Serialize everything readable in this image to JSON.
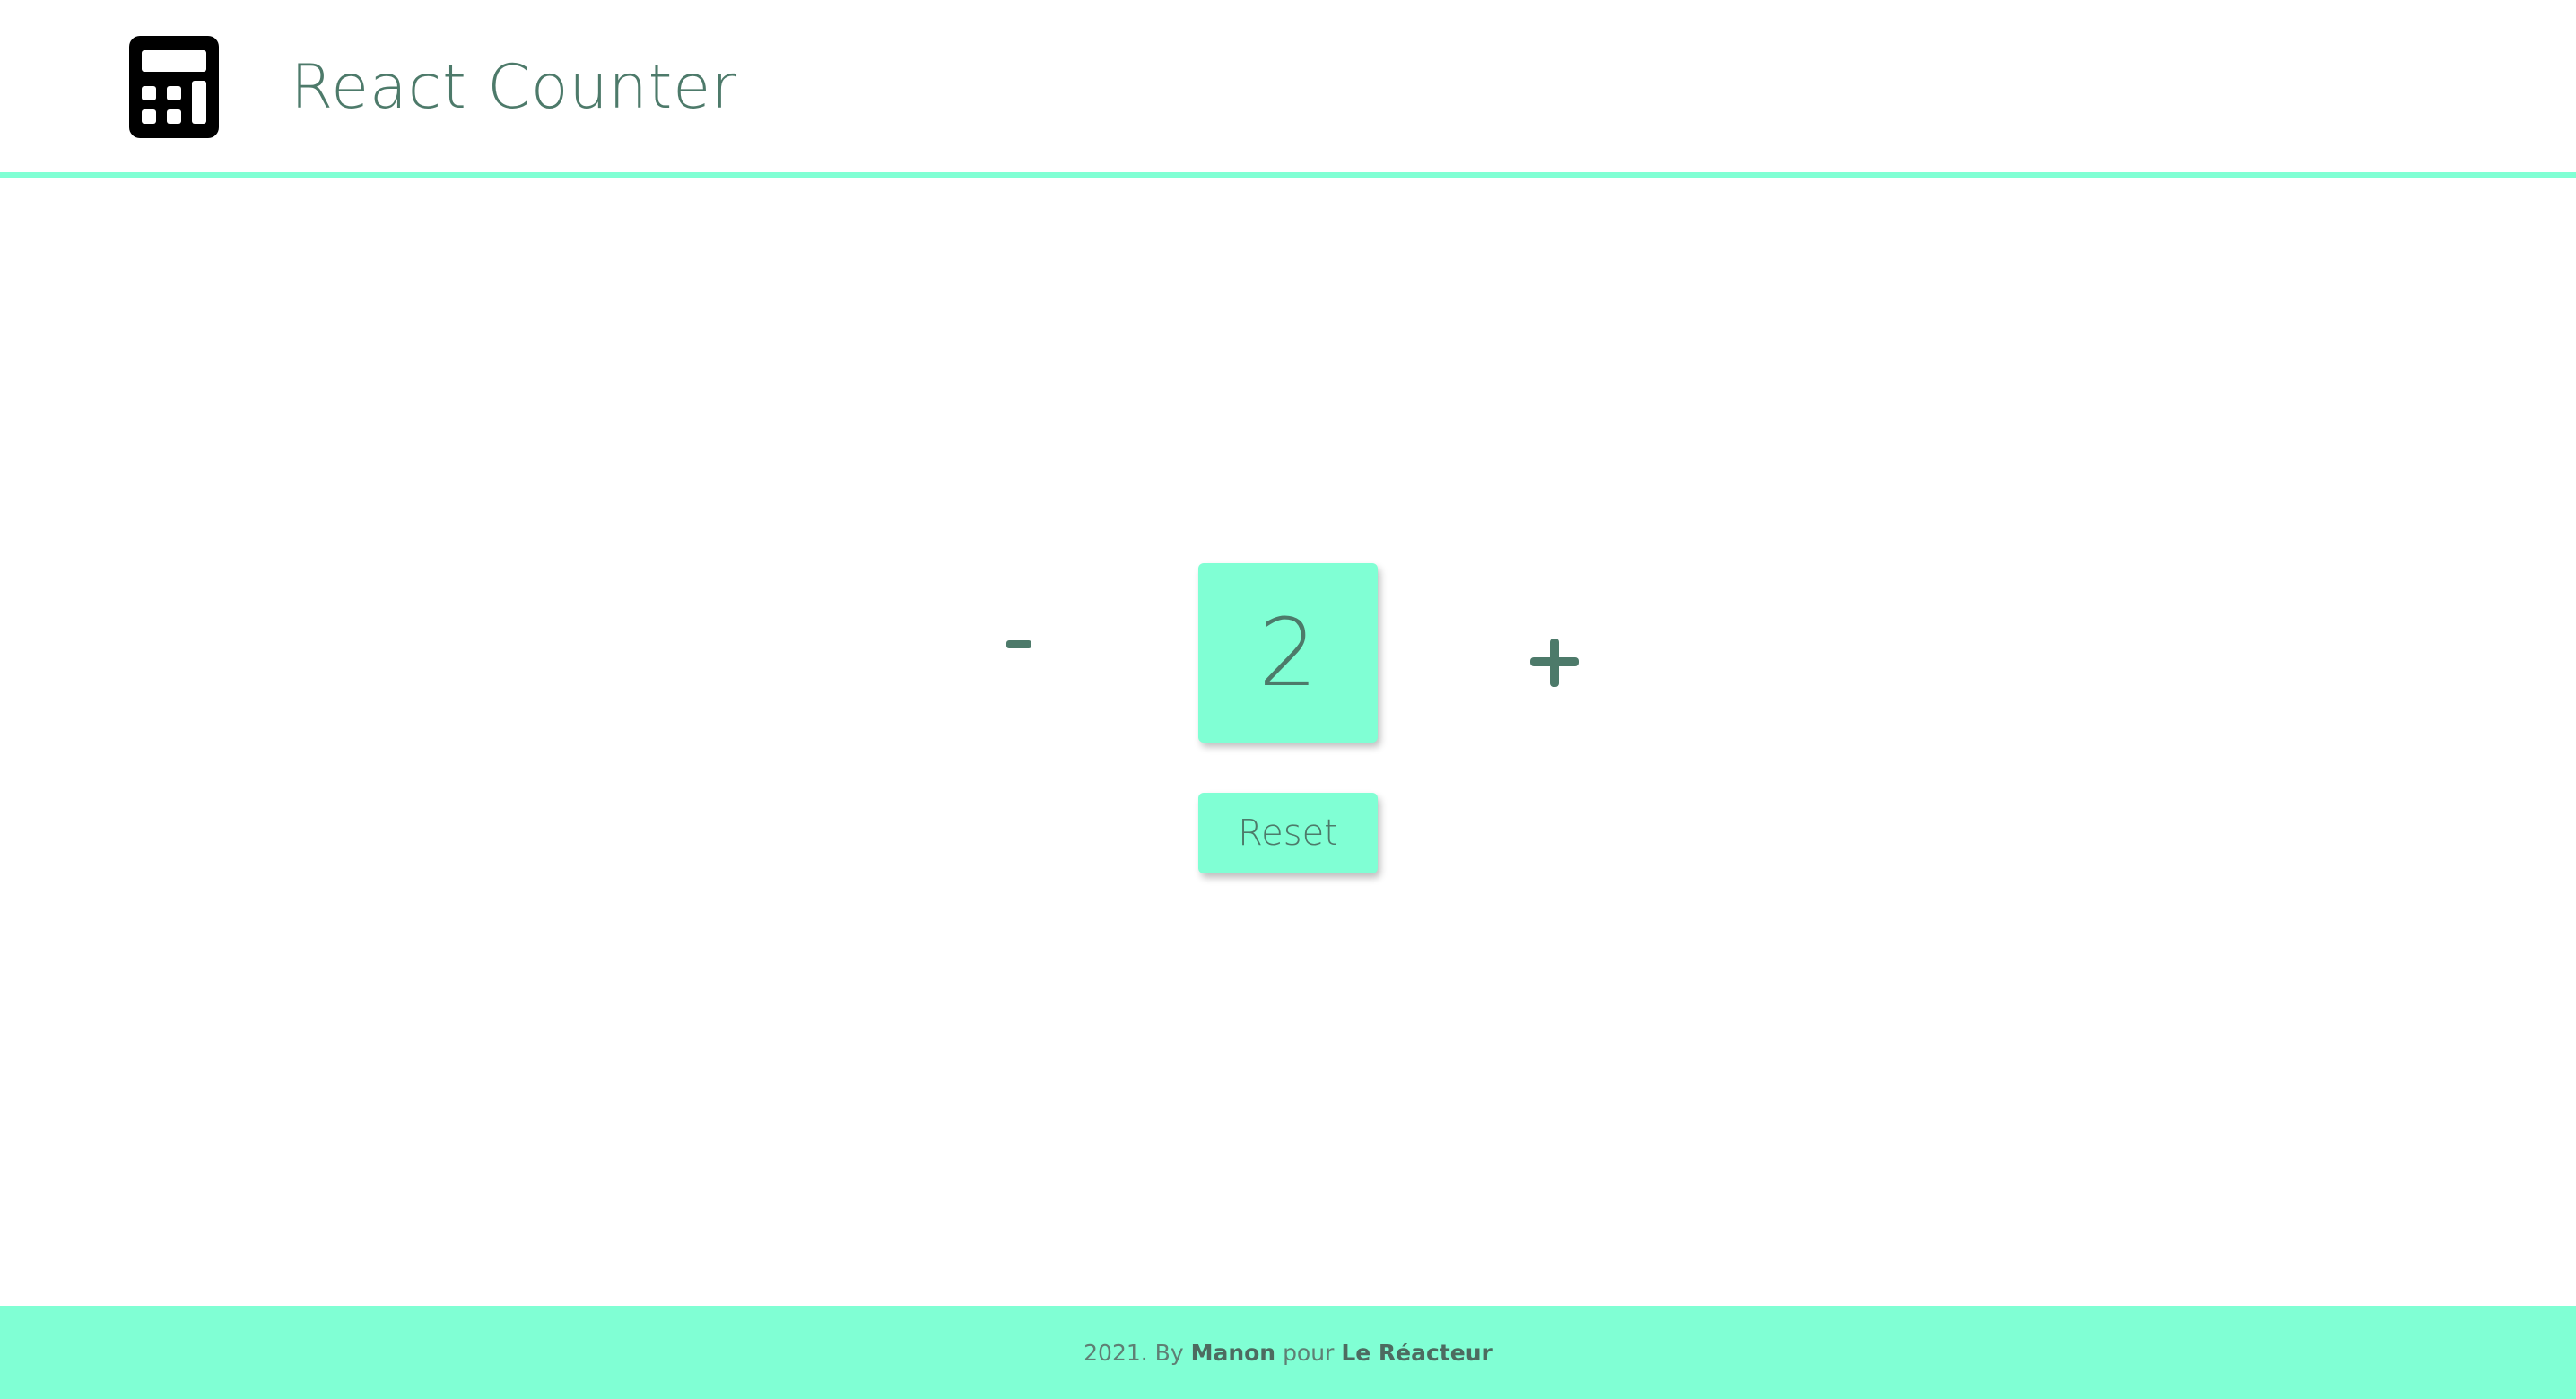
{
  "header": {
    "logo_icon": "calculator-icon",
    "title": "React Counter"
  },
  "counter": {
    "decrement_label": "-",
    "decrement_icon": "minus-icon",
    "value": "2",
    "increment_label": "+",
    "increment_icon": "plus-icon",
    "reset_label": "Reset"
  },
  "footer": {
    "year_text": "2021. By",
    "author": "Manon",
    "connector": "pour",
    "organization": "Le Réacteur"
  },
  "colors": {
    "accent": "#80ffd4",
    "text": "#4d7a6a",
    "background": "#ffffff",
    "logo": "#000000"
  }
}
